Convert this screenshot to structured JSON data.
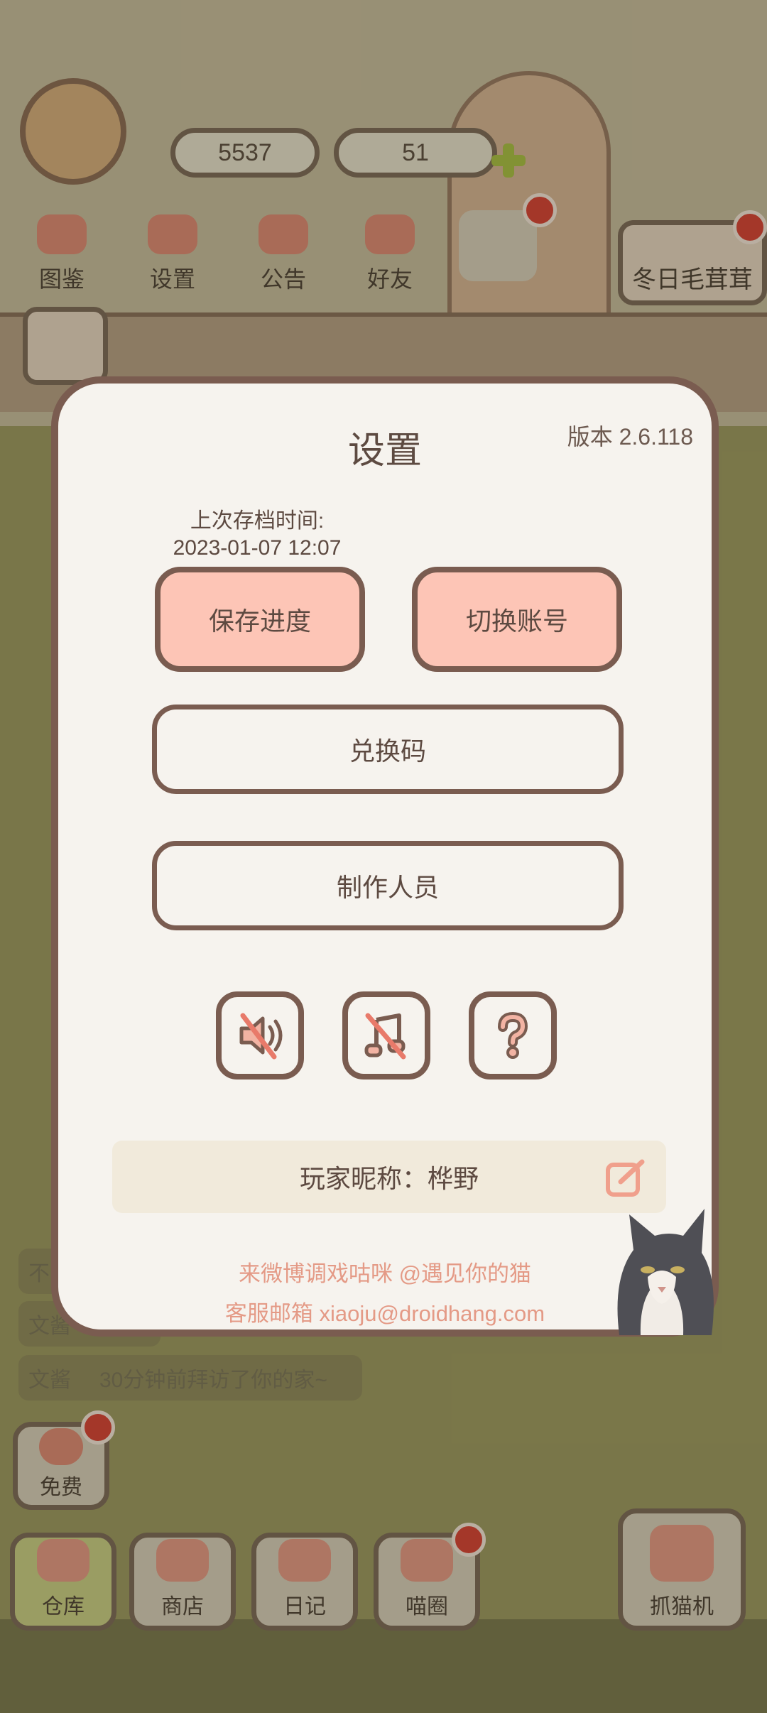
{
  "hud": {
    "coins": "5537",
    "hearts": "51"
  },
  "nav": {
    "items": [
      "图鉴",
      "设置",
      "公告",
      "好友"
    ],
    "side_tag": "冬日毛茸茸"
  },
  "feed": {
    "lines": [
      "不",
      "文酱",
      "文酱"
    ],
    "last_message": "30分钟前拜访了你的家~"
  },
  "free_label": "免费",
  "bottom_bar": [
    "仓库",
    "商店",
    "日记",
    "喵圈",
    "抓猫机"
  ],
  "settings": {
    "title": "设置",
    "version": "版本 2.6.118",
    "save_time_label": "上次存档时间:",
    "save_time_value": "2023-01-07 12:07",
    "save_button": "保存进度",
    "switch_account_button": "切换账号",
    "redeem_button": "兑换码",
    "credits_button": "制作人员",
    "nickname_label": "玩家昵称：桦野",
    "weibo_line": "来微博调戏咕咪 @遇见你的猫",
    "email_line": "客服邮箱 xiaoju@droidhang.com",
    "icons": [
      "sound-muted-icon",
      "music-muted-icon",
      "help-icon",
      "edit-icon"
    ]
  },
  "colors": {
    "dialog_bg": "#f6f3ee",
    "dialog_border": "#7a5c50",
    "pink_button": "#fdc5b6",
    "footer_text": "#e49a86",
    "nickname_bg": "#f1eadb"
  }
}
